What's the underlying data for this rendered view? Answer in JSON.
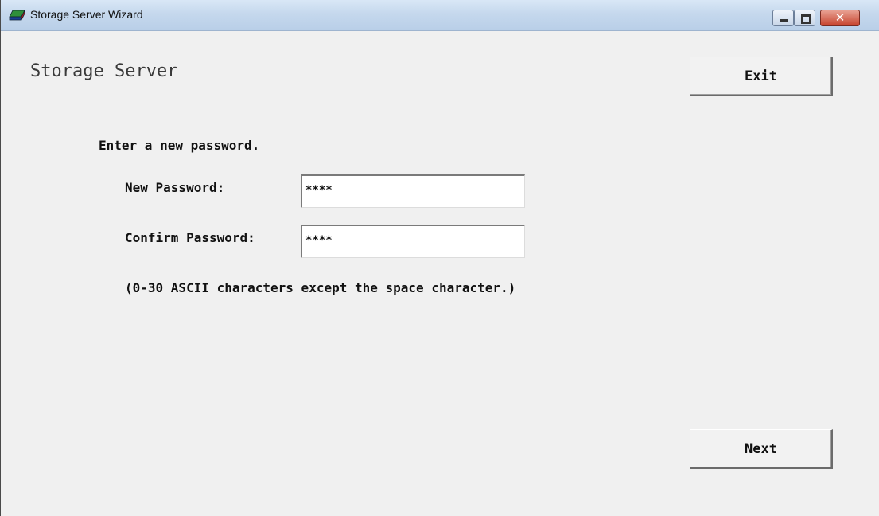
{
  "window": {
    "title": "Storage Server Wizard"
  },
  "header": {
    "heading": "Storage Server"
  },
  "buttons": {
    "exit_label": "Exit",
    "next_label": "Next"
  },
  "form": {
    "instruction": "Enter a new password.",
    "new_password_label": "New Password:",
    "new_password_value": "****",
    "confirm_password_label": "Confirm Password:",
    "confirm_password_value": "****",
    "hint": "(0-30 ASCII characters except the space character.)"
  },
  "icons": {
    "app": "storage-drive-icon",
    "minimize": "minimize-icon",
    "maximize": "maximize-icon",
    "close": "close-icon"
  },
  "colors": {
    "titlebar": "#c5d8ed",
    "client_background": "#f0f0f0",
    "close_button": "#c7442e"
  }
}
